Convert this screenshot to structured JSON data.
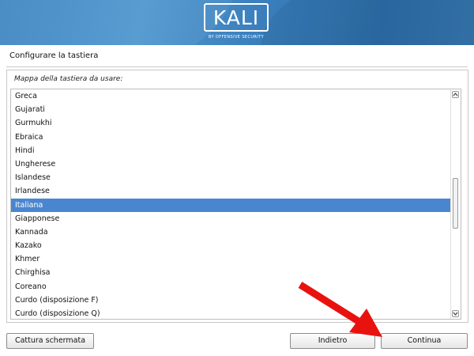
{
  "window": {
    "title": "Configurare la tastiera"
  },
  "branding": {
    "logo_text": "KALI",
    "logo_subtitle": "BY OFFENSIVE SECURITY"
  },
  "keyboard_list": {
    "caption": "Mappa della tastiera da usare:",
    "items": [
      "Greca",
      "Gujarati",
      "Gurmukhi",
      "Ebraica",
      "Hindi",
      "Ungherese",
      "Islandese",
      "Irlandese",
      "Italiana",
      "Giapponese",
      "Kannada",
      "Kazako",
      "Khmer",
      "Chirghisa",
      "Coreano",
      "Curdo (disposizione F)",
      "Curdo (disposizione Q)"
    ],
    "selected": "Italiana"
  },
  "buttons": {
    "screenshot": "Cattura schermata",
    "back": "Indietro",
    "continue": "Continua"
  },
  "icons": {
    "scroll_up": "chevron-up-icon",
    "scroll_down": "chevron-down-icon",
    "annotation": "red-arrow-icon"
  },
  "colors": {
    "banner": "#3f86c2",
    "selection": "#4a86d0",
    "annotation_arrow": "#e8130f"
  }
}
